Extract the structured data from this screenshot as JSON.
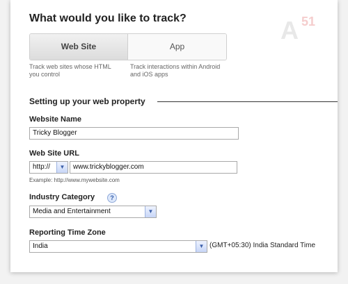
{
  "heading": "What would you like to track?",
  "tabs": [
    {
      "label": "Web Site",
      "description": "Track web sites whose HTML you control"
    },
    {
      "label": "App",
      "description": "Track interactions within Android and iOS apps"
    }
  ],
  "section_title": "Setting up your web property",
  "website_name": {
    "label": "Website Name",
    "value": "Tricky Blogger"
  },
  "website_url": {
    "label": "Web Site URL",
    "protocol": "http://",
    "value": "www.trickyblogger.com",
    "example": "Example: http://www.mywebsite.com"
  },
  "industry_category": {
    "label": "Industry Category",
    "help_icon": "?",
    "selected": "Media and Entertainment"
  },
  "reporting_time_zone": {
    "label": "Reporting Time Zone",
    "country": "India",
    "zone": "(GMT+05:30) India Standard Time"
  },
  "logo": {
    "letter": "A",
    "number": "51"
  },
  "colors": {
    "panel": "#ffffff",
    "background": "#f2f2f2",
    "dropdown_accent": "#3a5ea8"
  }
}
